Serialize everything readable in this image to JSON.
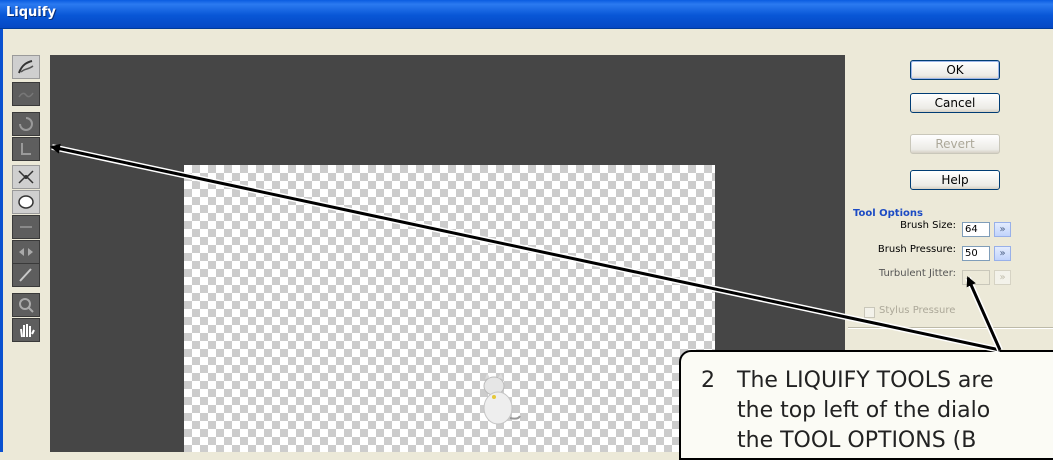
{
  "window": {
    "title": "Liquify"
  },
  "buttons": {
    "ok": "OK",
    "cancel": "Cancel",
    "revert": "Revert",
    "help": "Help"
  },
  "tool_options": {
    "title": "Tool Options",
    "brush_size_label": "Brush Size:",
    "brush_size_value": "64",
    "brush_pressure_label": "Brush Pressure:",
    "brush_pressure_value": "50",
    "turbulent_jitter_label": "Turbulent Jitter:",
    "turbulent_jitter_value": "",
    "stylus_pressure_label": "Stylus Pressure"
  },
  "tools": [
    {
      "icon": "warp-icon"
    },
    {
      "icon": "turbulence-icon"
    },
    {
      "icon": "twirl-clockwise-icon"
    },
    {
      "icon": "twirl-counterclockwise-icon"
    },
    {
      "icon": "pucker-icon"
    },
    {
      "icon": "bloat-icon"
    },
    {
      "icon": "shift-pixels-icon"
    },
    {
      "icon": "reflection-icon"
    },
    {
      "icon": "reconstruct-icon"
    },
    {
      "icon": "zoom-icon"
    },
    {
      "icon": "hand-icon"
    }
  ],
  "callout": {
    "number": "2",
    "line1": "The LIQUIFY TOOLS are",
    "line2": "the top left of the dialo",
    "line3": "the TOOL OPTIONS (B"
  },
  "colors": {
    "titlebar": "#0856d6",
    "preview_bg": "#464646",
    "dialog_bg": "#ece9d8",
    "accent_text": "#1c4bc4"
  }
}
